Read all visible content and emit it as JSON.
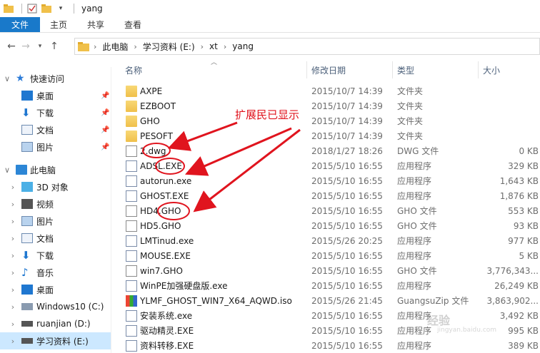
{
  "window": {
    "title": "yang"
  },
  "ribbon": {
    "tabs": [
      "文件",
      "主页",
      "共享",
      "查看"
    ]
  },
  "address": {
    "crumbs": [
      "此电脑",
      "学习资料 (E:)",
      "xt",
      "yang"
    ]
  },
  "sidebar": {
    "quick_access": "快速访问",
    "quick_items": [
      "桌面",
      "下载",
      "文档",
      "图片"
    ],
    "this_pc": "此电脑",
    "pc_items": [
      "3D 对象",
      "视频",
      "图片",
      "文档",
      "下载",
      "音乐",
      "桌面",
      "Windows10 (C:)",
      "ruanjian (D:)",
      "学习资料 (E:)"
    ]
  },
  "columns": {
    "name": "名称",
    "date": "修改日期",
    "type": "类型",
    "size": "大小"
  },
  "files": [
    {
      "name": "AXPE",
      "date": "2015/10/7 14:39",
      "type": "文件夹",
      "size": "",
      "icon": "folder-icon"
    },
    {
      "name": "EZBOOT",
      "date": "2015/10/7 14:39",
      "type": "文件夹",
      "size": "",
      "icon": "folder-icon"
    },
    {
      "name": "GHO",
      "date": "2015/10/7 14:39",
      "type": "文件夹",
      "size": "",
      "icon": "folder-icon"
    },
    {
      "name": "PESOFT",
      "date": "2015/10/7 14:39",
      "type": "文件夹",
      "size": "",
      "icon": "folder-icon"
    },
    {
      "name": "2.dwg",
      "date": "2018/1/27 18:26",
      "type": "DWG 文件",
      "size": "0 KB",
      "icon": "document-icon"
    },
    {
      "name": "ADSL.EXE",
      "date": "2015/5/10 16:55",
      "type": "应用程序",
      "size": "329 KB",
      "icon": "exe-icon"
    },
    {
      "name": "autorun.exe",
      "date": "2015/5/10 16:55",
      "type": "应用程序",
      "size": "1,643 KB",
      "icon": "exe-icon"
    },
    {
      "name": "GHOST.EXE",
      "date": "2015/5/10 16:55",
      "type": "应用程序",
      "size": "1,876 KB",
      "icon": "exe-icon"
    },
    {
      "name": "HD4.GHO",
      "date": "2015/5/10 16:55",
      "type": "GHO 文件",
      "size": "553 KB",
      "icon": "document-icon"
    },
    {
      "name": "HD5.GHO",
      "date": "2015/5/10 16:55",
      "type": "GHO 文件",
      "size": "93 KB",
      "icon": "document-icon"
    },
    {
      "name": "LMTinud.exe",
      "date": "2015/5/26 20:25",
      "type": "应用程序",
      "size": "977 KB",
      "icon": "exe-icon"
    },
    {
      "name": "MOUSE.EXE",
      "date": "2015/5/10 16:55",
      "type": "应用程序",
      "size": "5 KB",
      "icon": "exe-icon"
    },
    {
      "name": "win7.GHO",
      "date": "2015/5/10 16:55",
      "type": "GHO 文件",
      "size": "3,776,343...",
      "icon": "document-icon"
    },
    {
      "name": "WinPE加强硬盘版.exe",
      "date": "2015/5/10 16:55",
      "type": "应用程序",
      "size": "26,249 KB",
      "icon": "exe-icon"
    },
    {
      "name": "YLMF_GHOST_WIN7_X64_AQWD.iso",
      "date": "2015/5/26 21:45",
      "type": "GuangsuZip 文件",
      "size": "3,863,902...",
      "icon": "zip-icon"
    },
    {
      "name": "安装系统.exe",
      "date": "2015/5/10 16:55",
      "type": "应用程序",
      "size": "3,492 KB",
      "icon": "exe-icon"
    },
    {
      "name": "驱动精灵.EXE",
      "date": "2015/5/10 16:55",
      "type": "应用程序",
      "size": "995 KB",
      "icon": "exe-icon"
    },
    {
      "name": "资料转移.EXE",
      "date": "2015/5/10 16:55",
      "type": "应用程序",
      "size": "389 KB",
      "icon": "exe-icon"
    }
  ],
  "annotation": {
    "text": "扩展民已显示",
    "color": "#e0141e"
  },
  "watermark": {
    "text": "经验",
    "sub": "jingyan.baidu.com"
  }
}
